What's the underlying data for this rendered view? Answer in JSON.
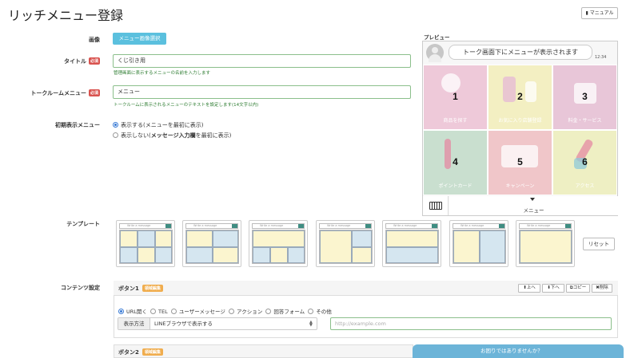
{
  "page": {
    "title": "リッチメニュー登録",
    "manual_label": "マニュアル"
  },
  "form": {
    "image_label": "画像",
    "image_button": "メニュー画像選択",
    "title_label": "タイトル",
    "required_badge": "必須",
    "title_value": "くじ引き用",
    "title_help": "管理画面に表示するメニューの名前を入力します",
    "chatroom_label": "トークルームメニュー",
    "chatroom_value": "メニュー",
    "chatroom_help": "トークルームに表示されるメニューのテキストを設定します(14文字以内)",
    "initial_label": "初期表示メニュー",
    "initial_opt1_bold": "表示する(メニュー",
    "initial_opt1_rest": "を最初に表示)",
    "initial_opt2_a": "表示しない(",
    "initial_opt2_bold": "メッセージ入力欄",
    "initial_opt2_rest": "を最初に表示)"
  },
  "preview": {
    "label": "プレビュー",
    "bubble_text": "トーク画面下にメニューが表示されます",
    "time": "12:34",
    "cells": [
      {
        "num": "1",
        "caption": "商品を探す",
        "bg": "#eec9d9"
      },
      {
        "num": "2",
        "caption": "お気に入り店舗登録",
        "bg": "#f3efc2"
      },
      {
        "num": "3",
        "caption": "料金・サービス",
        "bg": "#e8c6d8"
      },
      {
        "num": "4",
        "caption": "ポイントカード",
        "bg": "#c9dfcf"
      },
      {
        "num": "5",
        "caption": "キャンペーン",
        "bg": "#f0c6c9"
      },
      {
        "num": "6",
        "caption": "アクセス",
        "bg": "#eeefc3"
      }
    ],
    "menu_label": "メニュー"
  },
  "templates": {
    "label": "テンプレート",
    "header_text": "Write a message",
    "reset_label": "リセット"
  },
  "content": {
    "label": "コンテンツ設定",
    "button1_title": "ボタン1",
    "button2_title": "ボタン2",
    "edit_badge": "領域編集",
    "btn_up": "上へ",
    "btn_down": "下へ",
    "btn_copy": "コピー",
    "btn_delete": "削除",
    "actions": [
      "URL開く",
      "TEL",
      "ユーザーメッセージ",
      "アクション",
      "回答フォーム",
      "その他"
    ],
    "method_label": "表示方法",
    "method_value": "LINEブラウザで表示する",
    "url_placeholder": "http://example.com"
  },
  "help_widget": {
    "text": "お困りではありませんか？"
  }
}
